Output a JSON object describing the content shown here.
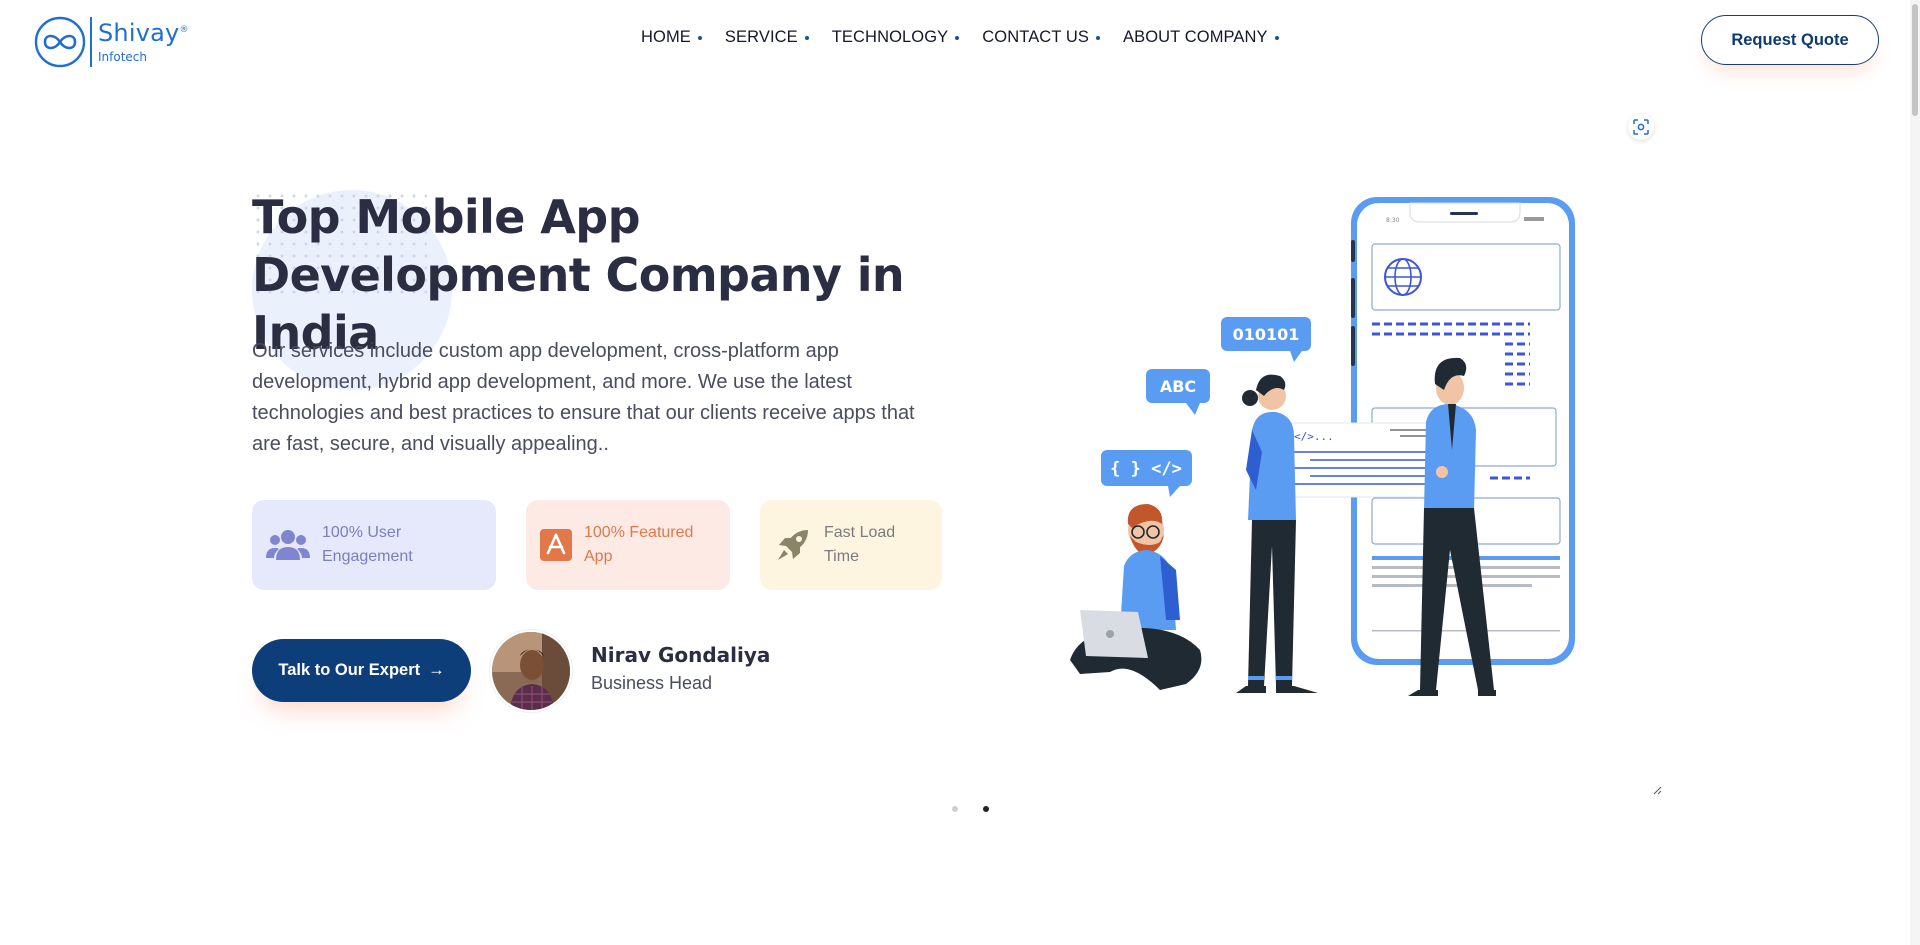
{
  "brand": {
    "name": "Shivay",
    "registered": "®",
    "subtitle": "Infotech",
    "icon": "infinity-logo-icon",
    "color": "#1f6fd1"
  },
  "nav": {
    "items": [
      {
        "label": "HOME"
      },
      {
        "label": "SERVICE"
      },
      {
        "label": "TECHNOLOGY"
      },
      {
        "label": "CONTACT US"
      },
      {
        "label": "ABOUT COMPANY"
      }
    ]
  },
  "header": {
    "quote_label": "Request Quote"
  },
  "hero": {
    "title": "Top Mobile App Development Company in India",
    "description": "Our services include custom app development, cross-platform app development, hybrid app development, and more. We use the latest technologies and best practices to ensure that our clients receive apps that are fast, secure, and visually appealing..",
    "features": [
      {
        "icon": "users-icon",
        "label": "100% User Engagement",
        "bg": "#e6e8fb",
        "color": "#7a80b8"
      },
      {
        "icon": "app-store-icon",
        "label": "100% Featured App",
        "bg": "#fdeae4",
        "color": "#e2774a"
      },
      {
        "icon": "rocket-icon",
        "label": "Fast Load Time",
        "bg": "#fdf5e0",
        "color": "#7b7b7b"
      }
    ],
    "cta_label": "Talk to Our Expert",
    "cta_arrow": "→",
    "expert": {
      "name": "Nirav Gondaliya",
      "role": "Business Head"
    }
  },
  "illustration": {
    "bubble_binary": "010101",
    "bubble_abc": "ABC",
    "bubble_code": "{ } </>",
    "card_code": "</>...",
    "phone_time": "8:30"
  },
  "colors": {
    "primary": "#0e3e7a",
    "accent_blue": "#5b9cf3",
    "heading": "#2b2d42"
  },
  "slider": {
    "active_index": 2,
    "count": 2
  }
}
